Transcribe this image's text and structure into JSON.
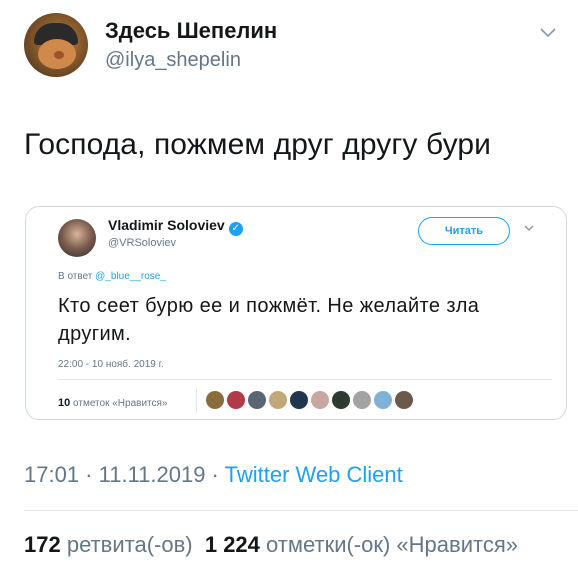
{
  "author": {
    "name": "Здесь Шепелин",
    "handle": "@ilya_shepelin"
  },
  "tweet": {
    "text": "Господа, пожмем друг другу бури"
  },
  "quoted": {
    "name": "Vladimir Soloviev",
    "handle": "@VRSoloviev",
    "follow_label": "Читать",
    "reply_prefix": "В ответ",
    "reply_to": "@_blue__rose_",
    "text": "Кто сеет бурю ее и пожмёт. Не желайте зла другим.",
    "timestamp": "22:00 - 10 нояб. 2019 г.",
    "likes_count": "10",
    "likes_label": "отметок «Нравится»",
    "likers": [
      "#8a6d3b",
      "#b03a48",
      "#5b6770",
      "#c2a77a",
      "#1f3550",
      "#c9a6a0",
      "#2f3b2f",
      "#a3a3a3",
      "#7fb2d8",
      "#6b5a4b"
    ]
  },
  "meta": {
    "time": "17:01 · 11.11.2019 · ",
    "client": "Twitter Web Client"
  },
  "stats": {
    "retweets_count": "172",
    "retweets_label": "ретвита(-ов)",
    "likes_count": "1 224",
    "likes_label": "отметки(-ок) «Нравится»"
  },
  "colors": {
    "accent": "#1da1f2",
    "muted": "#657786"
  }
}
